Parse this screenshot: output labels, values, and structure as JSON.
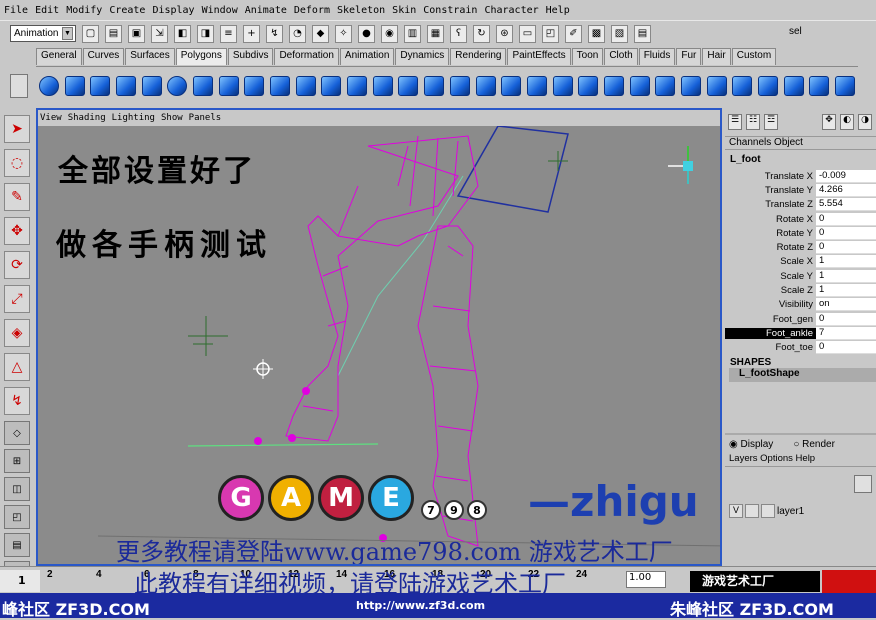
{
  "menubar": [
    "File",
    "Edit",
    "Modify",
    "Create",
    "Display",
    "Window",
    "Animate",
    "Deform",
    "Skeleton",
    "Skin",
    "Constrain",
    "Character",
    "Help"
  ],
  "status": {
    "mode": "Animation",
    "sel_label": "sel"
  },
  "shelf_tabs": [
    "General",
    "Curves",
    "Surfaces",
    "Polygons",
    "Subdivs",
    "Deformation",
    "Animation",
    "Dynamics",
    "Rendering",
    "PaintEffects",
    "Toon",
    "Cloth",
    "Fluids",
    "Fur",
    "Hair",
    "Custom"
  ],
  "shelf_active": "Polygons",
  "viewport": {
    "menu": [
      "View",
      "Shading",
      "Lighting",
      "Show",
      "Panels"
    ],
    "note_line1": "全部设置好了",
    "note_line2": "做各手柄测试"
  },
  "channel_box": {
    "menu": [
      "Channels",
      "Object"
    ],
    "object": "L_foot",
    "attributes": [
      {
        "name": "Translate X",
        "value": "-0.009"
      },
      {
        "name": "Translate Y",
        "value": "4.266"
      },
      {
        "name": "Translate Z",
        "value": "5.554"
      },
      {
        "name": "Rotate X",
        "value": "0"
      },
      {
        "name": "Rotate Y",
        "value": "0"
      },
      {
        "name": "Rotate Z",
        "value": "0"
      },
      {
        "name": "Scale X",
        "value": "1"
      },
      {
        "name": "Scale Y",
        "value": "1"
      },
      {
        "name": "Scale Z",
        "value": "1"
      },
      {
        "name": "Visibility",
        "value": "on"
      },
      {
        "name": "Foot_gen",
        "value": "0"
      },
      {
        "name": "Foot_ankle",
        "value": "7"
      },
      {
        "name": "Foot_toe",
        "value": "0"
      }
    ],
    "highlighted": "Foot_ankle",
    "shapes_header": "SHAPES",
    "shape_item": "L_footShape"
  },
  "layer_editor": {
    "display_label": "Display",
    "render_label": "Render",
    "menu": [
      "Layers",
      "Options",
      "Help"
    ],
    "layer_flag": "V",
    "layer_name": "layer1"
  },
  "timeline": {
    "start_frame": "1",
    "ticks": [
      "2",
      "4",
      "6",
      "8",
      "10",
      "12",
      "14",
      "16",
      "18",
      "20",
      "22",
      "24"
    ],
    "current_value": "1.00"
  },
  "overlays": {
    "logo_letters": [
      "G",
      "A",
      "M",
      "E"
    ],
    "logo_digits": [
      "7",
      "9",
      "8"
    ],
    "brand": "—zhigu",
    "subtitle1": "更多教程请登陆www.game798.com 游戏艺术工厂",
    "subtitle2": "此教程有详细视频，请登陆游戏艺术工厂",
    "blackbox_text": "游戏艺术工厂",
    "banner_left": "峰社区  ZF3D.COM",
    "banner_url": "http://www.zf3d.com",
    "banner_right": "朱峰社区  ZF3D.COM"
  },
  "colors": {
    "viewport_bg": "#8b8b8b",
    "wire": "#e000e0",
    "highlight_border": "#2a58c8",
    "banner": "#1b2aa0"
  }
}
